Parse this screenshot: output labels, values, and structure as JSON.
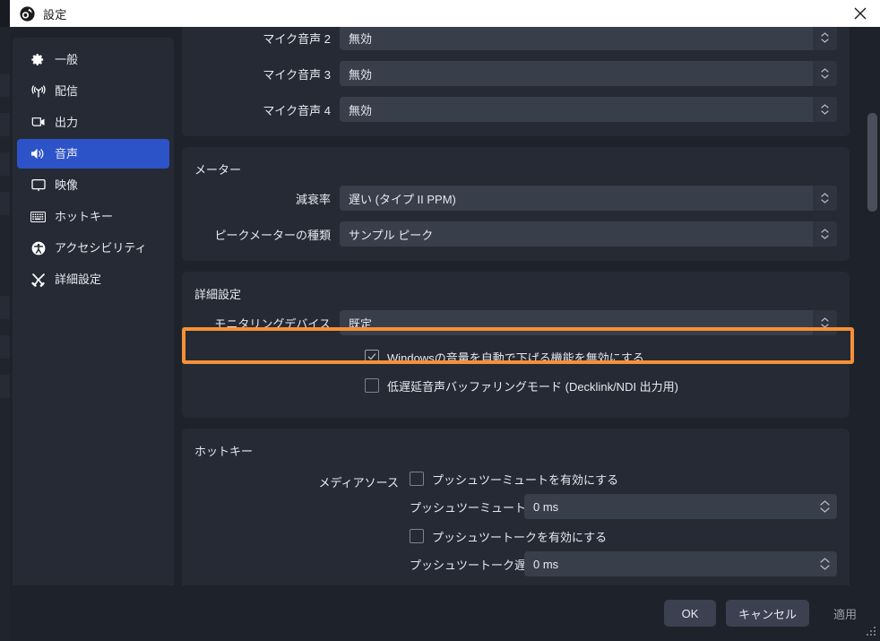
{
  "window": {
    "title": "設定",
    "logo_icon": "obs-logo-icon",
    "close_icon": "close-icon"
  },
  "sidebar": {
    "items": [
      {
        "label": "一般",
        "icon": "gear-icon",
        "selected": false
      },
      {
        "label": "配信",
        "icon": "broadcast-icon",
        "selected": false
      },
      {
        "label": "出力",
        "icon": "output-screen-icon",
        "selected": false
      },
      {
        "label": "音声",
        "icon": "speaker-icon",
        "selected": true
      },
      {
        "label": "映像",
        "icon": "monitor-icon",
        "selected": false
      },
      {
        "label": "ホットキー",
        "icon": "keyboard-icon",
        "selected": false
      },
      {
        "label": "アクセシビリティ",
        "icon": "accessibility-icon",
        "selected": false
      },
      {
        "label": "詳細設定",
        "icon": "tools-icon",
        "selected": false
      }
    ]
  },
  "content": {
    "devices_panel": {
      "rows": [
        {
          "label": "マイク音声 2",
          "value": "無効"
        },
        {
          "label": "マイク音声 3",
          "value": "無効"
        },
        {
          "label": "マイク音声 4",
          "value": "無効"
        }
      ]
    },
    "meter_panel": {
      "title": "メーター",
      "rows": [
        {
          "label": "減衰率",
          "value": "遅い (タイプ II PPM)"
        },
        {
          "label": "ピークメーターの種類",
          "value": "サンプル ピーク"
        }
      ]
    },
    "advanced_panel": {
      "title": "詳細設定",
      "monitoring_device": {
        "label": "モニタリングデバイス",
        "value": "既定"
      },
      "checkboxes": [
        {
          "label": "Windowsの音量を自動で下げる機能を無効にする",
          "checked": true
        },
        {
          "label": "低遅延音声バッファリングモード (Decklink/NDI 出力用)",
          "checked": false
        }
      ]
    },
    "hotkey_panel": {
      "title": "ホットキー",
      "source_label": "メディアソース",
      "push_to_mute": {
        "label": "プッシュツーミュートを有効にする",
        "checked": false
      },
      "push_to_mute_delay": {
        "label": "プッシュツーミュート遅延",
        "value": "0 ms"
      },
      "push_to_talk": {
        "label": "プッシュツートークを有効にする",
        "checked": false
      },
      "push_to_talk_delay": {
        "label": "プッシュツートーク遅延",
        "value": "0 ms"
      }
    }
  },
  "footer": {
    "ok": "OK",
    "cancel": "キャンセル",
    "apply": "適用"
  },
  "highlight": {
    "color": "#f79036",
    "target": "monitoring-device-row"
  }
}
